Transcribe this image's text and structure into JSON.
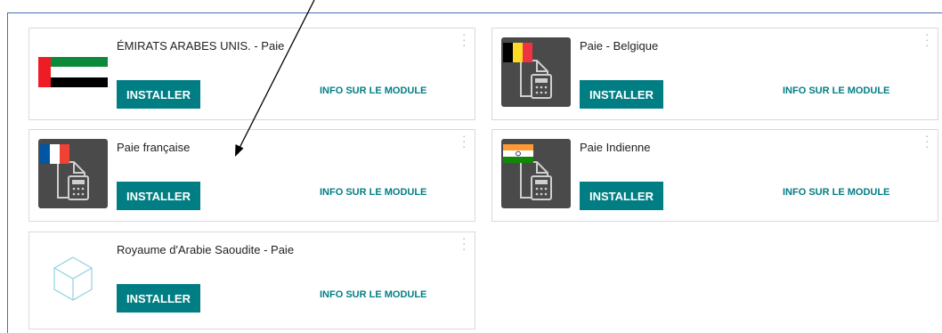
{
  "cards": [
    {
      "title": "ÉMIRATS ARABES UNIS. - Paie",
      "install_label": "INSTALLER",
      "info_label": "INFO SUR LE MODULE",
      "icon": "uae-flag-icon"
    },
    {
      "title": "Paie - Belgique",
      "install_label": "INSTALLER",
      "info_label": "INFO SUR LE MODULE",
      "icon": "belgium-payroll-icon"
    },
    {
      "title": "Paie française",
      "install_label": "INSTALLER",
      "info_label": "INFO SUR LE MODULE",
      "icon": "france-payroll-icon"
    },
    {
      "title": "Paie Indienne",
      "install_label": "INSTALLER",
      "info_label": "INFO SUR LE MODULE",
      "icon": "india-payroll-icon"
    },
    {
      "title": "Royaume d'Arabie Saoudite - Paie",
      "install_label": "INSTALLER",
      "info_label": "INFO SUR LE MODULE",
      "icon": "cube-icon"
    }
  ],
  "colors": {
    "accent": "#017e84",
    "card_border": "#d9d9d9",
    "frame_border": "#4a6fb0"
  }
}
